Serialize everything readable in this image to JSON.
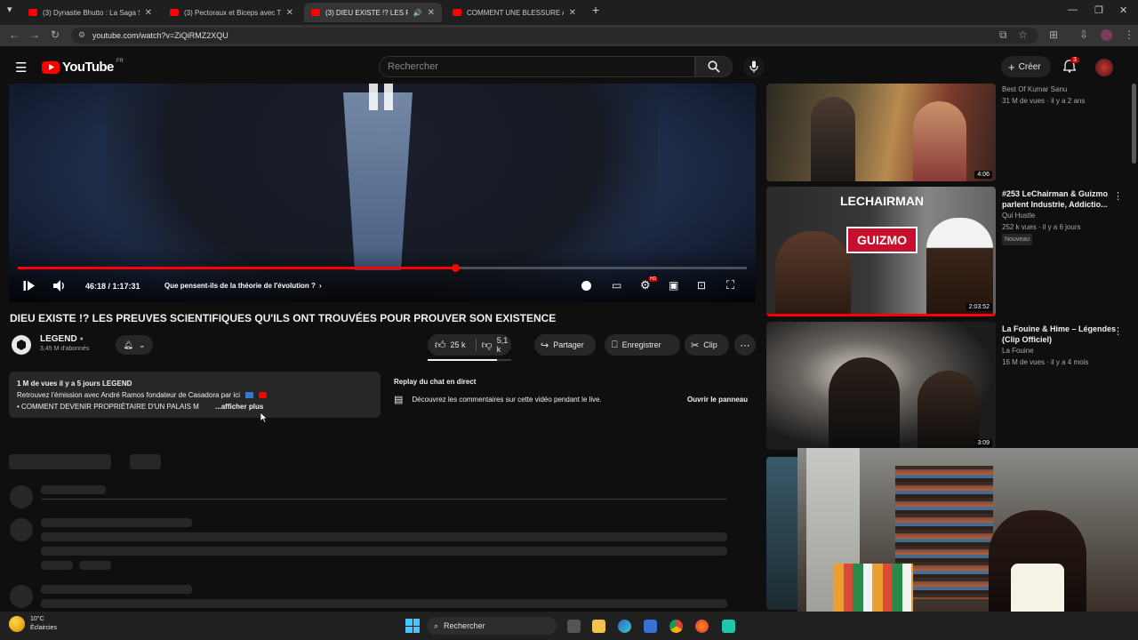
{
  "browser": {
    "tabs": [
      {
        "title": "(3) Dynastie Bhutto : La Saga S"
      },
      {
        "title": "(3) Pectoraux et Biceps avec Ti"
      },
      {
        "title": "(3) DIEU EXISTE !? LES PREU"
      },
      {
        "title": "COMMENT UNE BLESSURE A R"
      }
    ],
    "url": "youtube.com/watch?v=ZiQiRMZ2XQU"
  },
  "youtube": {
    "logo": "YouTube",
    "region": "FR",
    "search_placeholder": "Rechercher",
    "create_label": "Créer",
    "notif_count": "3"
  },
  "player": {
    "time": "46:18 / 1:17:31",
    "chapter": "Que pensent-ils de la théorie de l'évolution ?",
    "progress_fraction": 0.6
  },
  "video": {
    "title": "DIEU EXISTE !? LES PREUVES SCIENTIFIQUES QU'ILS ONT TROUVÉES POUR PROUVER SON EXISTENCE",
    "channel": "LEGEND",
    "subscribers": "3,45 M d'abonnés",
    "likes": "25 k",
    "dislikes": "5,1 k",
    "share_label": "Partager",
    "save_label": "Enregistrer",
    "clip_label": "Clip"
  },
  "description": {
    "meta": "1 M de vues  il y a 5 jours  LEGEND",
    "line1": "Retrouvez l'émission avec André Ramos fondateur de Casadora par ici",
    "line2": "• COMMENT DEVENIR PROPRIÉTAIRE D'UN PALAIS M",
    "more": "...afficher plus"
  },
  "chat": {
    "title": "Replay du chat en direct",
    "text": "Découvrez les commentaires sur cette vidéo pendant le live.",
    "button": "Ouvrir le panneau"
  },
  "sidebar": {
    "items": [
      {
        "channel": "Best Of Kumar Sanu",
        "meta": "31 M de vues · il y a 2 ans",
        "duration": "4:06"
      },
      {
        "title": "#253 LeChairman & Guizmo parlent Industrie, Addictio...",
        "channel": "Qui Hustle",
        "meta": "252 k vues · il y a 6 jours",
        "badge": "Nouveau",
        "duration": "2:03:52",
        "thumb_text1": "LECHAIRMAN",
        "thumb_text2": "GUIZMO"
      },
      {
        "title": "La Fouine & Hime – Légendes (Clip Officiel)",
        "channel": "La Fouine",
        "meta": "16 M de vues · il y a 4 mois",
        "duration": "3:09"
      }
    ]
  },
  "taskbar": {
    "temp": "10°C",
    "weather": "Éclaircies",
    "search": "Rechercher"
  }
}
